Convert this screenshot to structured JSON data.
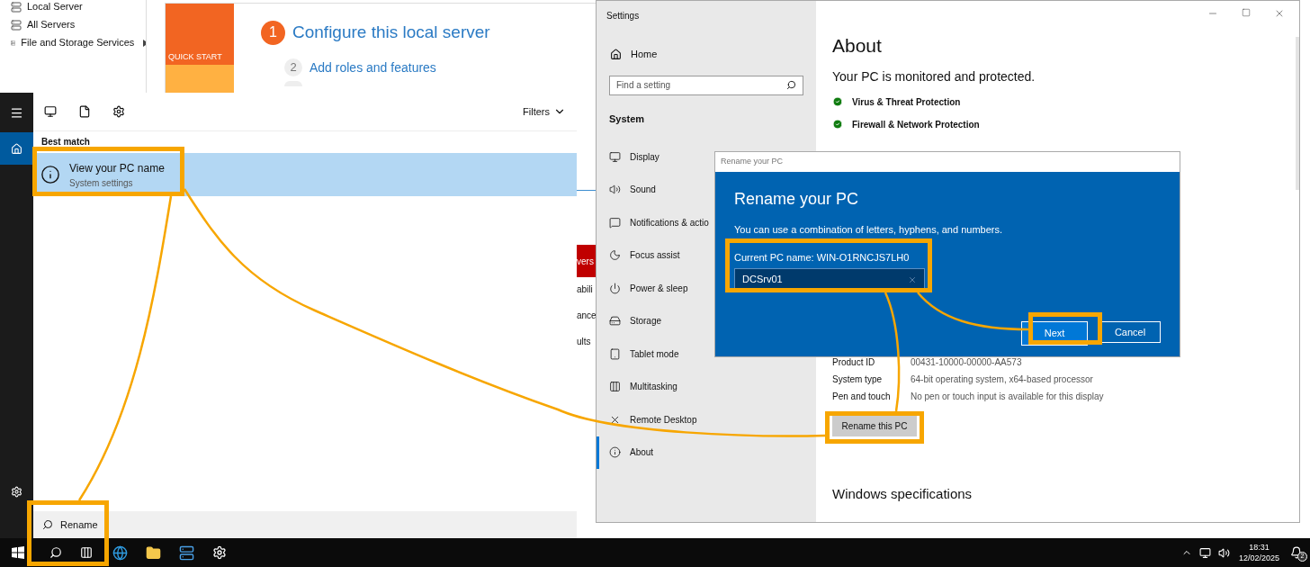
{
  "server_manager": {
    "nav_items": [
      {
        "label": "Local Server",
        "has_submenu": false
      },
      {
        "label": "All Servers",
        "has_submenu": false
      },
      {
        "label": "File and Storage Services",
        "has_submenu": true
      }
    ],
    "quick_start_tile": "QUICK START",
    "steps": [
      {
        "number": "1",
        "label": "Configure this local server",
        "primary": true
      },
      {
        "number": "2",
        "label": "Add roles and features",
        "primary": false
      }
    ],
    "peek_texts": [
      {
        "text": "vers",
        "kind": "banner"
      },
      {
        "text": "abili",
        "kind": "plain"
      },
      {
        "text": "ance",
        "kind": "plain"
      },
      {
        "text": "ults",
        "kind": "plain"
      }
    ]
  },
  "search_panel": {
    "rail": [
      {
        "kind": "menu",
        "selected": false
      },
      {
        "kind": "home",
        "selected": true
      }
    ],
    "filters": "Filters",
    "section": "Best match",
    "results": [
      {
        "title": "View your PC name",
        "subtitle": "System settings",
        "selected": true
      }
    ],
    "query": "Rename"
  },
  "settings": {
    "title": "Settings",
    "home": "Home",
    "search_placeholder": "Find a setting",
    "group": "System",
    "nav_items": [
      {
        "label": "Display",
        "selected": false
      },
      {
        "label": "Sound",
        "selected": false
      },
      {
        "label": "Notifications & actio",
        "selected": false
      },
      {
        "label": "Focus assist",
        "selected": false
      },
      {
        "label": "Power & sleep",
        "selected": false
      },
      {
        "label": "Storage",
        "selected": false
      },
      {
        "label": "Tablet mode",
        "selected": false
      },
      {
        "label": "Multitasking",
        "selected": false
      },
      {
        "label": "Remote Desktop",
        "selected": false
      },
      {
        "label": "About",
        "selected": true
      }
    ],
    "heading": "About",
    "status": "Your PC is monitored and protected.",
    "protections": [
      "Virus & Threat Protection",
      "Firewall & Network Protection"
    ],
    "specs": [
      {
        "label": "Product ID",
        "value": "00431-10000-00000-AA573"
      },
      {
        "label": "System type",
        "value": "64-bit operating system, x64-based processor"
      },
      {
        "label": "Pen and touch",
        "value": "No pen or touch input is available for this display"
      }
    ],
    "rename_button": "Rename this PC",
    "section2": "Windows specifications"
  },
  "dialog": {
    "window_title": "Rename your PC",
    "heading": "Rename your PC",
    "description": "You can use a combination of letters, hyphens, and numbers.",
    "current_name": "Current PC name: WIN-O1RNCJS7LH0",
    "value": "DCSrv01",
    "buttons": [
      {
        "label": "Next",
        "primary": true
      },
      {
        "label": "Cancel",
        "primary": false
      }
    ]
  },
  "taskbar": {
    "time": "18:31",
    "date": "12/02/2025",
    "notifications": "2"
  }
}
